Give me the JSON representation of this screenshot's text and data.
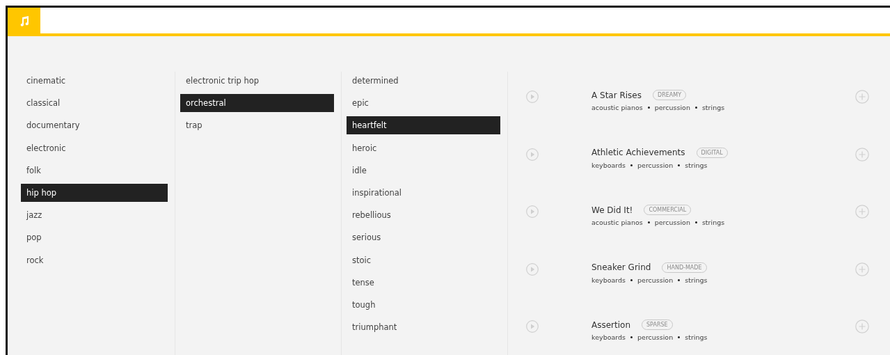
{
  "genres": [
    {
      "label": "cinematic",
      "selected": false
    },
    {
      "label": "classical",
      "selected": false
    },
    {
      "label": "documentary",
      "selected": false
    },
    {
      "label": "electronic",
      "selected": false
    },
    {
      "label": "folk",
      "selected": false
    },
    {
      "label": "hip hop",
      "selected": true
    },
    {
      "label": "jazz",
      "selected": false
    },
    {
      "label": "pop",
      "selected": false
    },
    {
      "label": "rock",
      "selected": false
    }
  ],
  "styles": [
    {
      "label": "electronic trip hop",
      "selected": false
    },
    {
      "label": "orchestral",
      "selected": true
    },
    {
      "label": "trap",
      "selected": false
    }
  ],
  "moods": [
    {
      "label": "determined",
      "selected": false
    },
    {
      "label": "epic",
      "selected": false
    },
    {
      "label": "heartfelt",
      "selected": true
    },
    {
      "label": "heroic",
      "selected": false
    },
    {
      "label": "idle",
      "selected": false
    },
    {
      "label": "inspirational",
      "selected": false
    },
    {
      "label": "rebellious",
      "selected": false
    },
    {
      "label": "serious",
      "selected": false
    },
    {
      "label": "stoic",
      "selected": false
    },
    {
      "label": "tense",
      "selected": false
    },
    {
      "label": "tough",
      "selected": false
    },
    {
      "label": "triumphant",
      "selected": false
    }
  ],
  "tracks": [
    {
      "title": "A Star Rises",
      "tag": "DREAMY",
      "instruments": [
        "acoustic pianos",
        "percussion",
        "strings"
      ]
    },
    {
      "title": "Athletic Achievements",
      "tag": "DIGITAL",
      "instruments": [
        "keyboards",
        "percussion",
        "strings"
      ]
    },
    {
      "title": "We Did It!",
      "tag": "COMMERCIAL",
      "instruments": [
        "acoustic pianos",
        "percussion",
        "strings"
      ]
    },
    {
      "title": "Sneaker Grind",
      "tag": "HAND-MADE",
      "instruments": [
        "keyboards",
        "percussion",
        "strings"
      ]
    },
    {
      "title": "Assertion",
      "tag": "SPARSE",
      "instruments": [
        "keyboards",
        "percussion",
        "strings"
      ]
    }
  ]
}
